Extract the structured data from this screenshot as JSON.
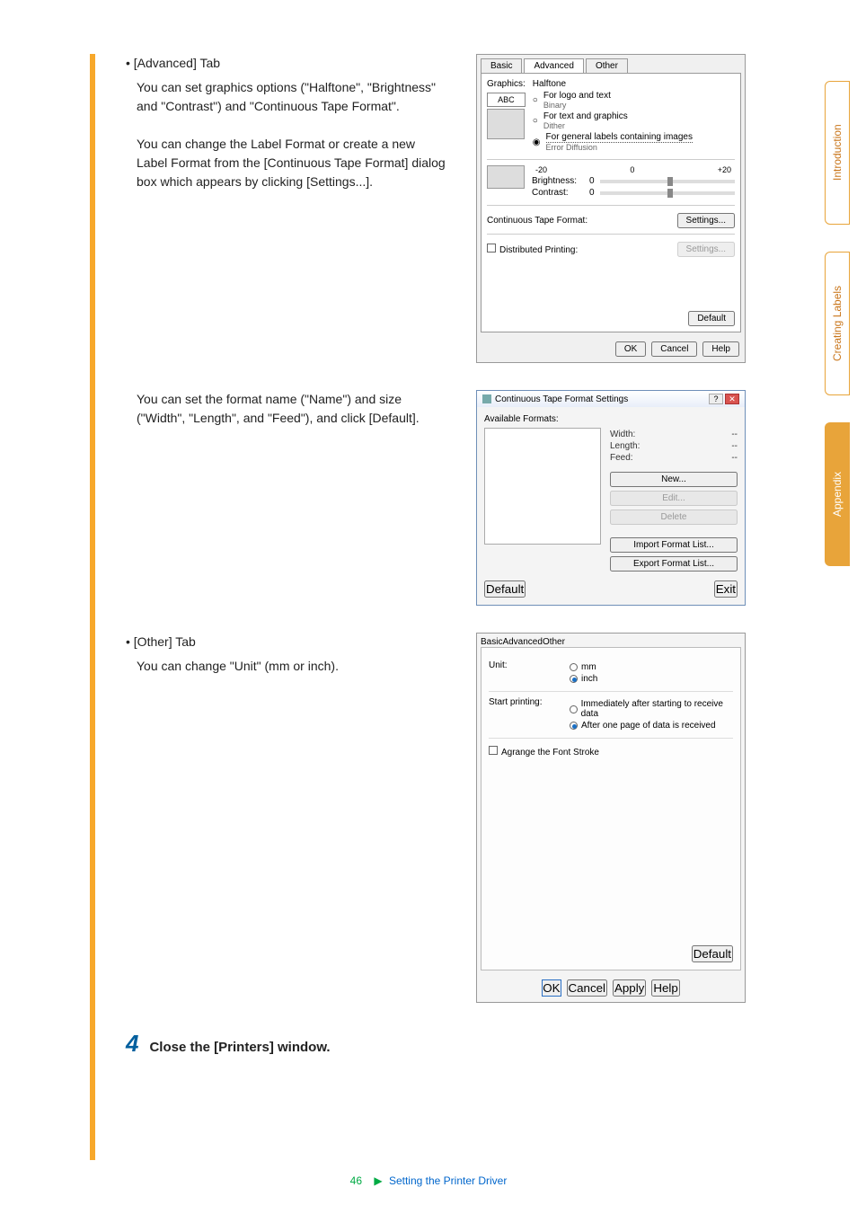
{
  "content": {
    "advanced_tab_title": "• [Advanced] Tab",
    "advanced_p1": "You can set graphics options (\"Halftone\", \"Brightness\" and \"Contrast\") and \"Continuous Tape Format\".",
    "advanced_p2": "You can change the Label Format or create a new Label Format from the [Continuous Tape Format] dialog box which appears by clicking [Settings...].",
    "format_p": "You can set the format name (\"Name\") and size (\"Width\", \"Length\", and \"Feed\"), and click [Default].",
    "other_tab_title": "• [Other] Tab",
    "other_p": "You can change \"Unit\" (mm or inch).",
    "step_num": "4",
    "step_text": "Close the [Printers] window."
  },
  "adv_dialog": {
    "tab_basic": "Basic",
    "tab_advanced": "Advanced",
    "tab_other": "Other",
    "graphics_label": "Graphics:",
    "halftone_group": "Halftone",
    "halftone_opt1": "For logo and text",
    "halftone_opt1_sub": "Binary",
    "halftone_opt2": "For text and graphics",
    "halftone_opt2_sub": "Dither",
    "halftone_opt3": "For general labels containing images",
    "halftone_opt3_sub": "Error Diffusion",
    "brightness_label": "Brightness:",
    "contrast_label": "Contrast:",
    "slider_min": "-20",
    "slider_zero": "0",
    "slider_max": "+20",
    "slider_val": "0",
    "continuous_label": "Continuous Tape Format:",
    "settings_btn": "Settings...",
    "distributed_label": "Distributed Printing:",
    "settings_btn2": "Settings...",
    "default_btn": "Default",
    "ok": "OK",
    "cancel": "Cancel",
    "help": "Help"
  },
  "ctf_dialog": {
    "title": "Continuous Tape Format Settings",
    "available_label": "Available Formats:",
    "width_label": "Width:",
    "length_label": "Length:",
    "feed_label": "Feed:",
    "width_val": "--",
    "length_val": "--",
    "feed_val": "--",
    "new_btn": "New...",
    "edit_btn": "Edit...",
    "delete_btn": "Delete",
    "import_btn": "Import Format List...",
    "export_btn": "Export Format List...",
    "default_btn": "Default",
    "exit_btn": "Exit"
  },
  "other_dialog": {
    "tab_basic": "Basic",
    "tab_advanced": "Advanced",
    "tab_other": "Other",
    "unit_label": "Unit:",
    "unit_mm": "mm",
    "unit_inch": "inch",
    "start_label": "Start printing:",
    "start_opt1": "Immediately after starting to receive data",
    "start_opt2": "After one page of data is received",
    "arrange_label": "Agrange the Font Stroke",
    "default_btn": "Default",
    "ok": "OK",
    "cancel": "Cancel",
    "apply": "Apply",
    "help": "Help"
  },
  "sidebar": {
    "intro": "Introduction",
    "creating": "Creating Labels",
    "appendix": "Appendix"
  },
  "footer": {
    "page": "46",
    "link": "Setting the Printer Driver"
  }
}
